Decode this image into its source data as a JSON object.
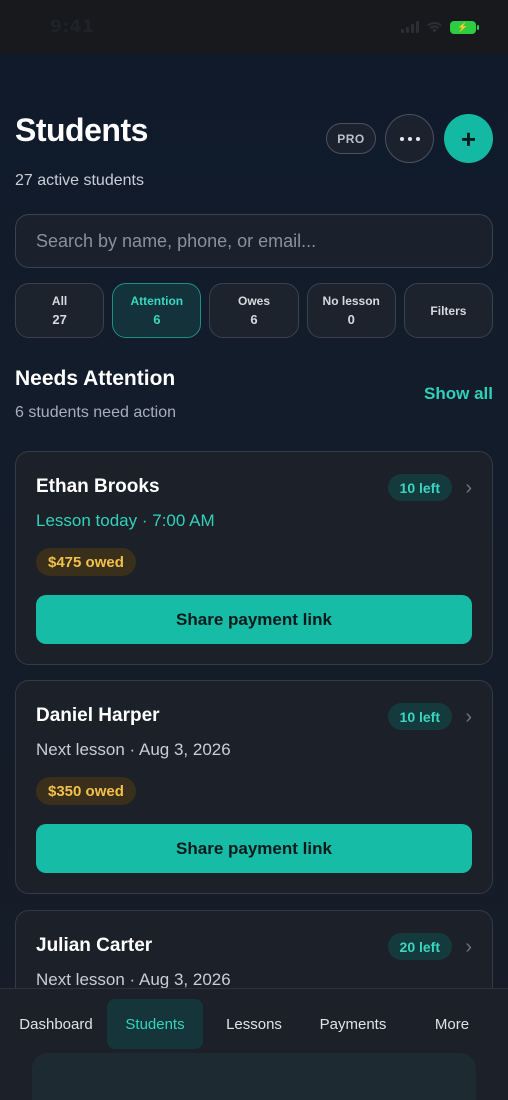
{
  "status_bar": {
    "time": "9:41"
  },
  "header": {
    "title": "Students",
    "subtitle": "27 active students",
    "pro_label": "PRO",
    "add_label": "+"
  },
  "search": {
    "placeholder": "Search by name, phone, or email..."
  },
  "filters": [
    {
      "label": "All",
      "count": "27"
    },
    {
      "label": "Attention",
      "count": "6",
      "active": true
    },
    {
      "label": "Owes",
      "count": "6"
    },
    {
      "label": "No lesson",
      "count": "0"
    },
    {
      "label": "Filters",
      "count": ""
    }
  ],
  "section": {
    "title": "Needs Attention",
    "subtitle": "6 students need action",
    "show_all": "Show all"
  },
  "students": [
    {
      "name": "Ethan Brooks",
      "left": "10 left",
      "next": "Lesson today · 7:00 AM",
      "owed": "$475 owed",
      "action": "Share payment link"
    },
    {
      "name": "Daniel Harper",
      "left": "10 left",
      "next": "Next lesson · Aug 3, 2026",
      "owed": "$350 owed",
      "action": "Share payment link"
    },
    {
      "name": "Julian Carter",
      "left": "20 left",
      "next": "Next lesson · Aug 3, 2026"
    }
  ],
  "tabbar": {
    "items": [
      "Dashboard",
      "Students",
      "Lessons",
      "Payments",
      "More"
    ],
    "active": "Students"
  },
  "colors": {
    "accent": "#13b9a3",
    "owed_text": "#f2c14a",
    "background": "#131c2a"
  }
}
